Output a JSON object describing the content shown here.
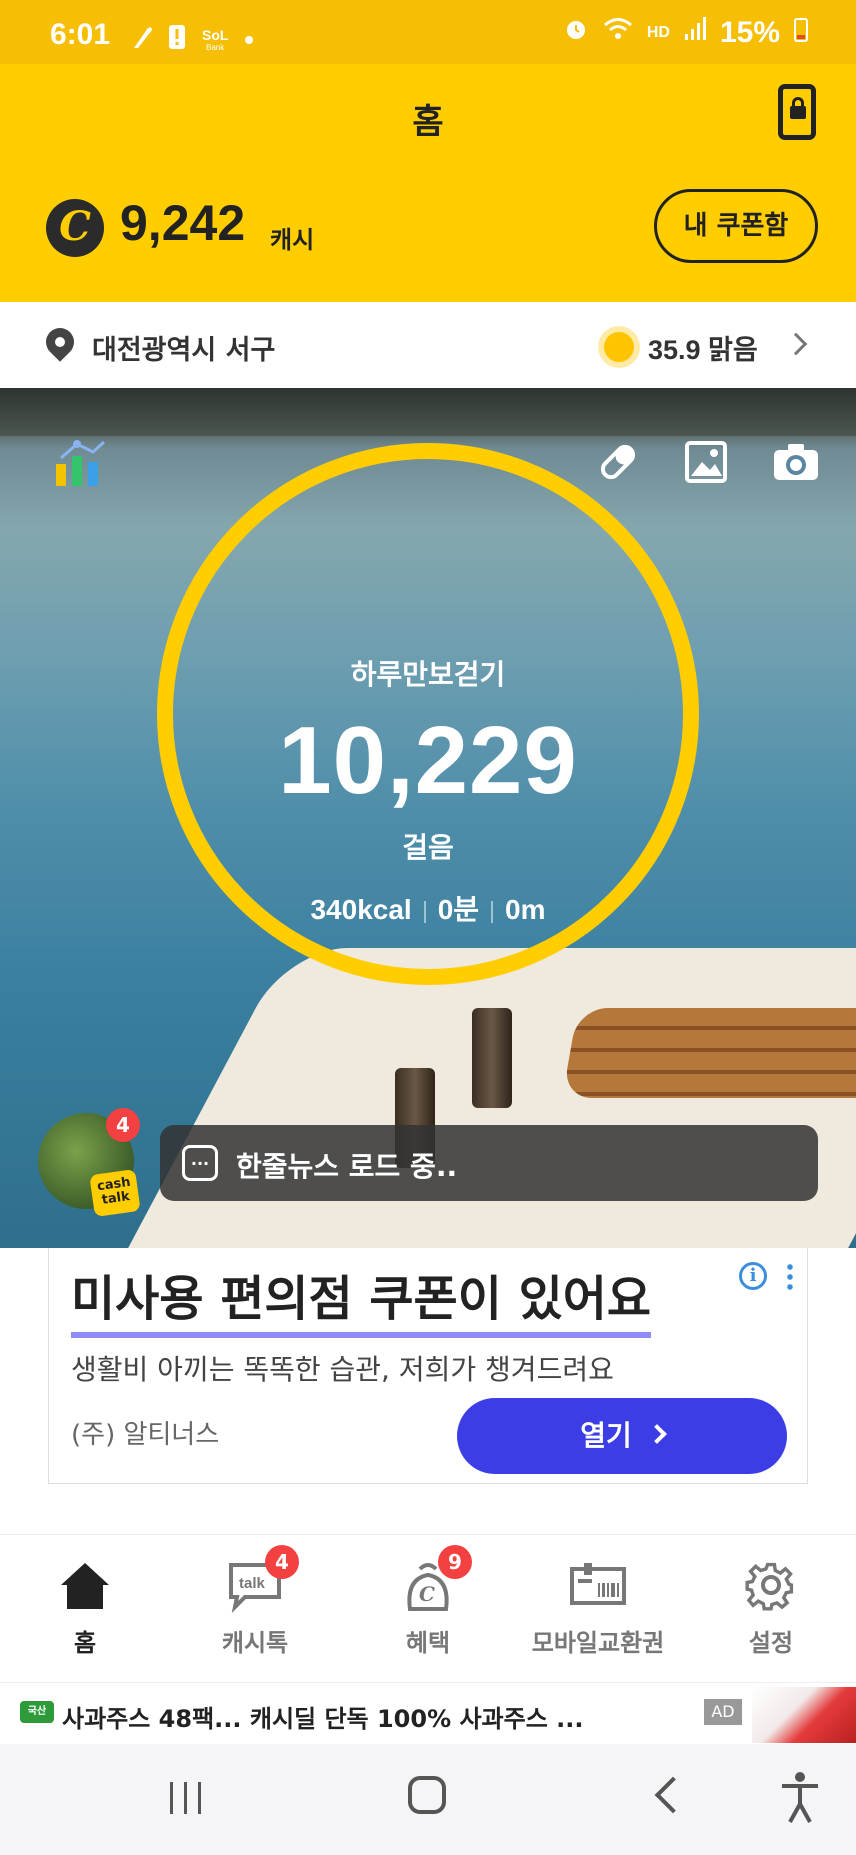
{
  "status_bar": {
    "time": "6:01",
    "battery": "15%",
    "network_label": "HD"
  },
  "header": {
    "title": "홈",
    "cash_symbol": "C",
    "cash_amount": "9,242",
    "cash_unit": "캐시",
    "coupon_button": "내 쿠폰함"
  },
  "location": {
    "city": "대전광역시 서구",
    "weather": "35.9 맑음"
  },
  "pedometer": {
    "title": "하루만보걷기",
    "steps": "10,229",
    "unit": "걸음",
    "kcal": "340kcal",
    "minutes": "0분",
    "distance": "0m"
  },
  "cashtalk": {
    "badge": "4",
    "sticker_line1": "cash",
    "sticker_line2": "talk",
    "news_text": "한줄뉴스 로드 중..",
    "news_dots": "..."
  },
  "ad_card": {
    "title": "미사용 편의점 쿠폰이 있어요",
    "subtitle": "생활비 아끼는 똑똑한 습관, 저희가 챙겨드려요",
    "company": "(주) 알티너스",
    "open_button": "열기",
    "info_icon": "i"
  },
  "bottom_nav": {
    "items": [
      {
        "label": "홈",
        "badge": ""
      },
      {
        "label": "캐시톡",
        "badge": "4"
      },
      {
        "label": "혜택",
        "badge": "9"
      },
      {
        "label": "모바일교환권",
        "badge": ""
      },
      {
        "label": "설정",
        "badge": ""
      }
    ]
  },
  "ad_strip": {
    "logo_text": "국산",
    "text": "사과주스 48팩...   캐시딜 단독 100% 사과주스  ...",
    "ad_label": "AD"
  },
  "colors": {
    "brand_yellow": "#ffcd00",
    "status_yellow": "#f6bf05",
    "badge_red": "#f34141",
    "button_blue": "#3d3de6"
  }
}
